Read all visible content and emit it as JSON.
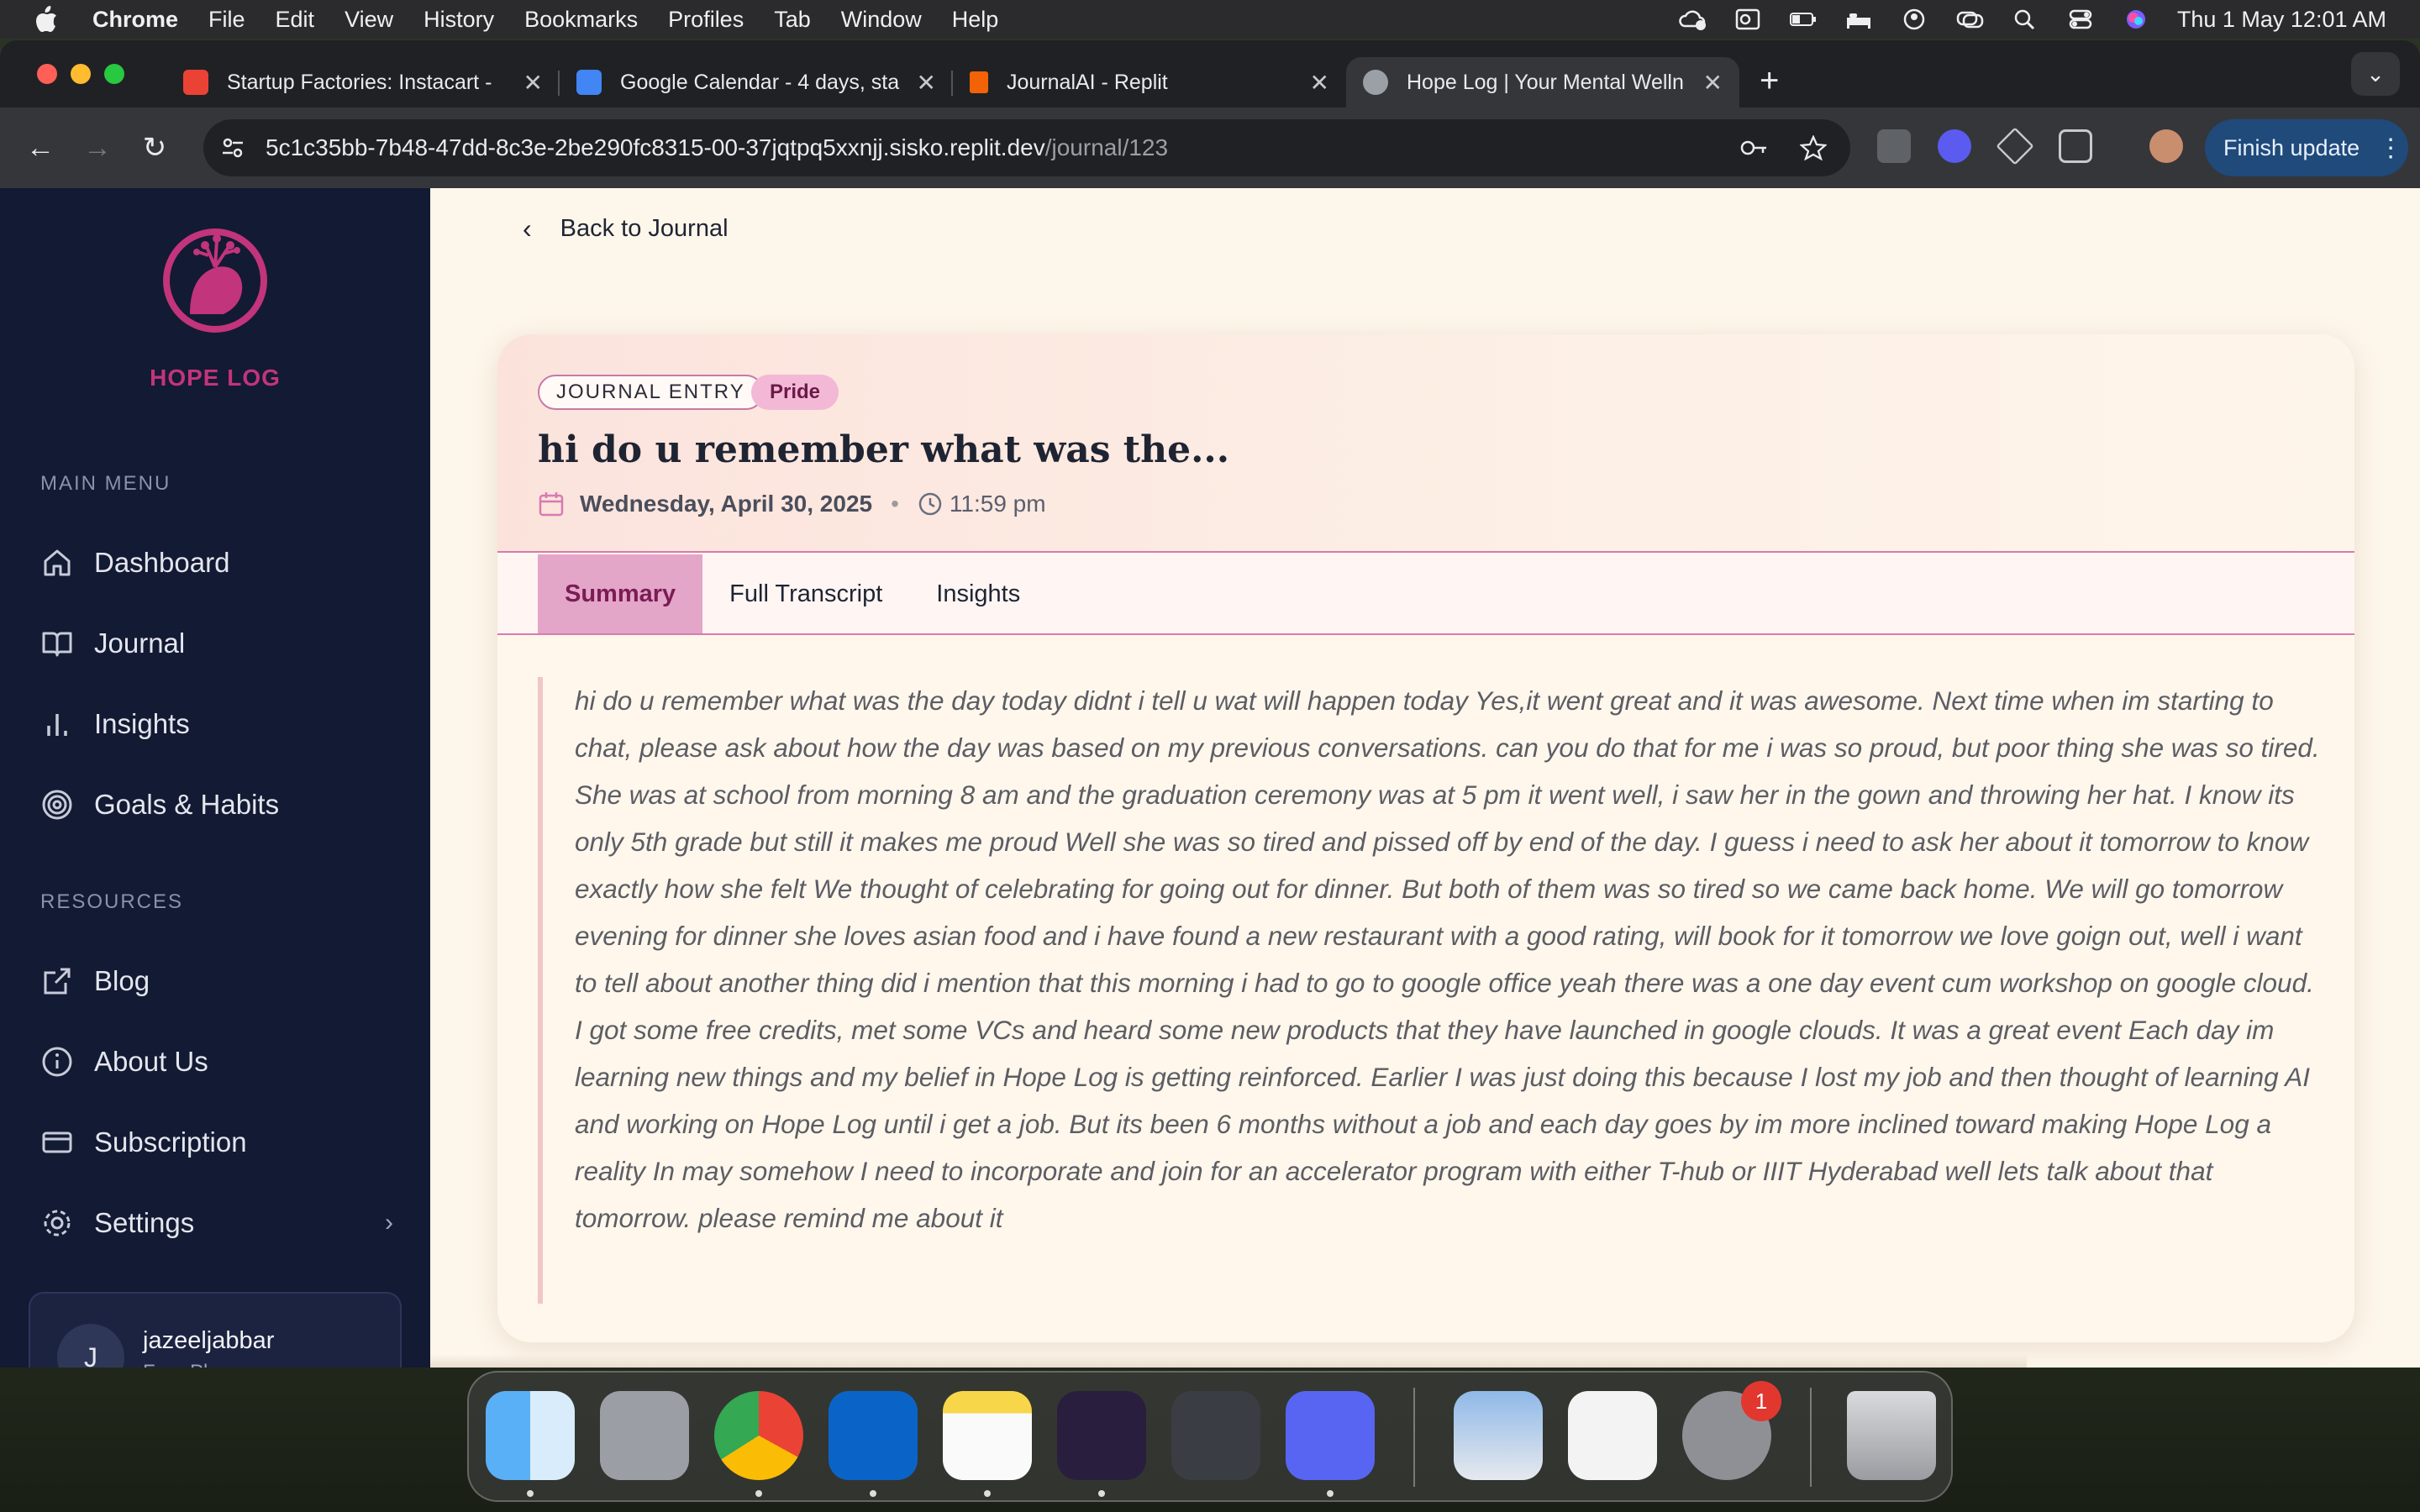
{
  "menubar": {
    "items": [
      "Chrome",
      "File",
      "Edit",
      "View",
      "History",
      "Bookmarks",
      "Profiles",
      "Tab",
      "Window",
      "Help"
    ],
    "clock": "Thu 1 May  12:01 AM"
  },
  "browser": {
    "tabs": [
      {
        "title": "Startup Factories: Instacart -",
        "favicon_color": "#ea4335"
      },
      {
        "title": "Google Calendar - 4 days, sta",
        "favicon_color": "#4285f4"
      },
      {
        "title": "JournalAI - Replit",
        "favicon_color": "#f26207"
      },
      {
        "title": "Hope Log | Your Mental Welln",
        "favicon_color": "#9aa0a6"
      }
    ],
    "url_host": "5c1c35bb-7b48-47dd-8c3e-2be290fc8315-00-37jqtpq5xxnjj.sisko.replit.dev",
    "url_path": "/journal/123",
    "finish_update": "Finish update"
  },
  "sidebar": {
    "logo_text": "HOPE LOG",
    "main_menu_label": "MAIN MENU",
    "main_items": [
      "Dashboard",
      "Journal",
      "Insights",
      "Goals & Habits"
    ],
    "resources_label": "RESOURCES",
    "resource_items": [
      "Blog",
      "About Us",
      "Subscription",
      "Settings"
    ],
    "user": {
      "initial": "J",
      "name": "jazeeljabbar",
      "plan": "Free Plan"
    }
  },
  "entry": {
    "back_label": "Back to Journal",
    "type_badge": "JOURNAL ENTRY",
    "emotion_badge": "Pride",
    "title": "hi do u remember what was the...",
    "date": "Wednesday, April 30, 2025",
    "time": "11:59 pm",
    "tabs": [
      "Summary",
      "Full Transcript",
      "Insights"
    ],
    "summary": "hi do u remember what was the day today didnt i tell u wat will happen today Yes,it went great and it was awesome. Next time when im starting to chat, please ask about how the day was based on my previous conversations. can you do that for me i was so proud, but poor thing she was so tired. She was at school from morning 8 am and the graduation ceremony was at 5 pm it went well, i saw her in the gown and throwing her hat. I know its only 5th grade but still it makes me proud Well she was so tired and pissed off by end of the day. I guess i need to ask her about it tomorrow to know exactly how she felt We thought of celebrating for going out for dinner. But both of them was so tired so we came back home. We will go tomorrow evening for dinner she loves asian food and i have found a new restaurant with a good rating, will book for it tomorrow we love goign out, well i want to tell about another thing did i mention that this morning i had to go to google office yeah there was a one day event cum workshop on google cloud. I got some free credits, met some VCs and heard some new products that they have launched in google clouds. It was a great event Each day im learning new things and my belief in Hope Log is getting reinforced. Earlier I was just doing this because I lost my job and then thought of learning AI and working on Hope Log until i get a job. But its been 6 months without a job and each day goes by im more inclined toward making Hope Log a reality In may somehow I need to incorporate and join for an accelerator program with either T-hub or IIIT Hyderabad well lets talk about that tomorrow. please remind me about it"
  },
  "dock": {
    "apps": [
      "finder-icon",
      "launchpad-icon",
      "chrome-icon",
      "outlook-icon",
      "notes-icon",
      "obsidian-icon",
      "perplexity-icon",
      "discord-icon",
      "preview-icon",
      "textedit-icon",
      "system-settings-icon",
      "trash-icon"
    ],
    "settings_badge": "1"
  },
  "colors": {
    "accent": "#c2347b",
    "sidebar_bg": "#131a33",
    "page_bg": "#fdf6ea",
    "active_tab": "#e3a6c8"
  }
}
